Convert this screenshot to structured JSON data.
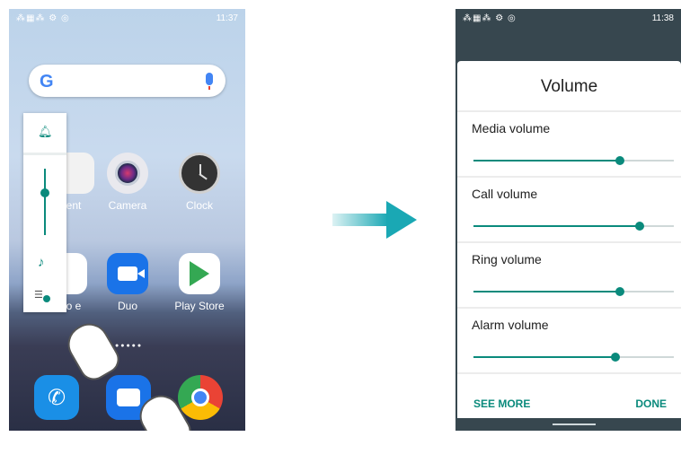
{
  "left_phone": {
    "status": {
      "icons": "⁂▦⁂ ⚙ ◎",
      "time": "11:37"
    },
    "search": {
      "google_letter": "G"
    },
    "volume_panel": {
      "level": 0.7
    },
    "apps": [
      {
        "id": "contacts",
        "label": "ent"
      },
      {
        "id": "camera",
        "label": "Camera"
      },
      {
        "id": "clock",
        "label": "Clock"
      },
      {
        "id": "google",
        "label": "Goo  e"
      },
      {
        "id": "duo",
        "label": "Duo"
      },
      {
        "id": "play_store",
        "label": "Play Store"
      }
    ],
    "dock": [
      "phone",
      "messages",
      "chrome"
    ]
  },
  "right_phone": {
    "status": {
      "icons": "⁂▦⁂ ⚙ ◎",
      "time": "11:38"
    },
    "dialog": {
      "title": "Volume",
      "rows": [
        {
          "label": "Media volume",
          "level": 0.73
        },
        {
          "label": "Call volume",
          "level": 0.83
        },
        {
          "label": "Ring volume",
          "level": 0.73
        },
        {
          "label": "Alarm volume",
          "level": 0.71
        }
      ],
      "see_more": "SEE MORE",
      "done": "DONE"
    }
  },
  "colors": {
    "accent": "#0a8a7c",
    "arrow": "#1aa8b4"
  }
}
